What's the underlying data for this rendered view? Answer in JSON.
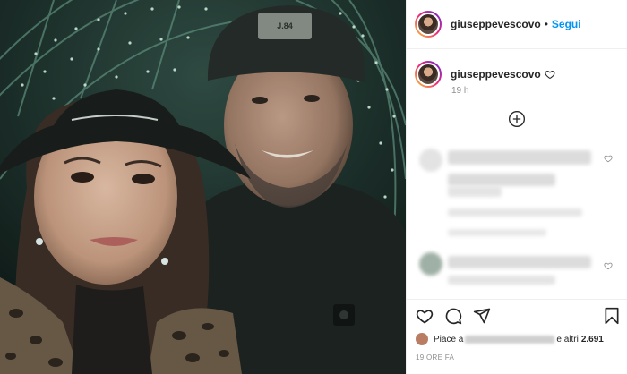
{
  "post": {
    "username": "giuseppevescovo",
    "follow_label": "Segui",
    "separator": "•"
  },
  "caption": {
    "username": "giuseppevescovo",
    "time_ago": "19 h"
  },
  "likes": {
    "prefix": "Piace a",
    "conjunction": "e altri",
    "count": "2.691"
  },
  "footer": {
    "date": "19 ORE FA"
  },
  "hat_text": "J.84",
  "colors": {
    "link": "#0095f6",
    "text": "#262626",
    "muted": "#8e8e8e"
  },
  "icons": [
    "heart-icon",
    "comment-icon",
    "share-icon",
    "save-icon",
    "plus-circle-icon"
  ]
}
